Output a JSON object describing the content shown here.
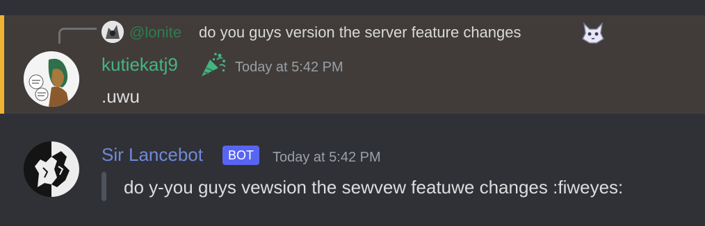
{
  "reply": {
    "author": "@lonite",
    "text": "do you guys version the server feature changes",
    "emoji": "fox-emoji"
  },
  "message1": {
    "author": "kutiekatj9",
    "badge_icon": "party-popper-icon",
    "timestamp": "Today at 5:42 PM",
    "content": ".uwu"
  },
  "message2": {
    "author": "Sir Lancebot",
    "bot_tag": "BOT",
    "timestamp": "Today at 5:42 PM",
    "content": "do y-you guys vewsion the sewvew featuwe changes :fiweyes:"
  },
  "colors": {
    "background": "#2f3136",
    "highlight_background": "#413c3a",
    "mention_accent": "#f0b232",
    "author1_color": "#43b581",
    "author2_color": "#7289da",
    "bot_tag_bg": "#5865f2"
  }
}
